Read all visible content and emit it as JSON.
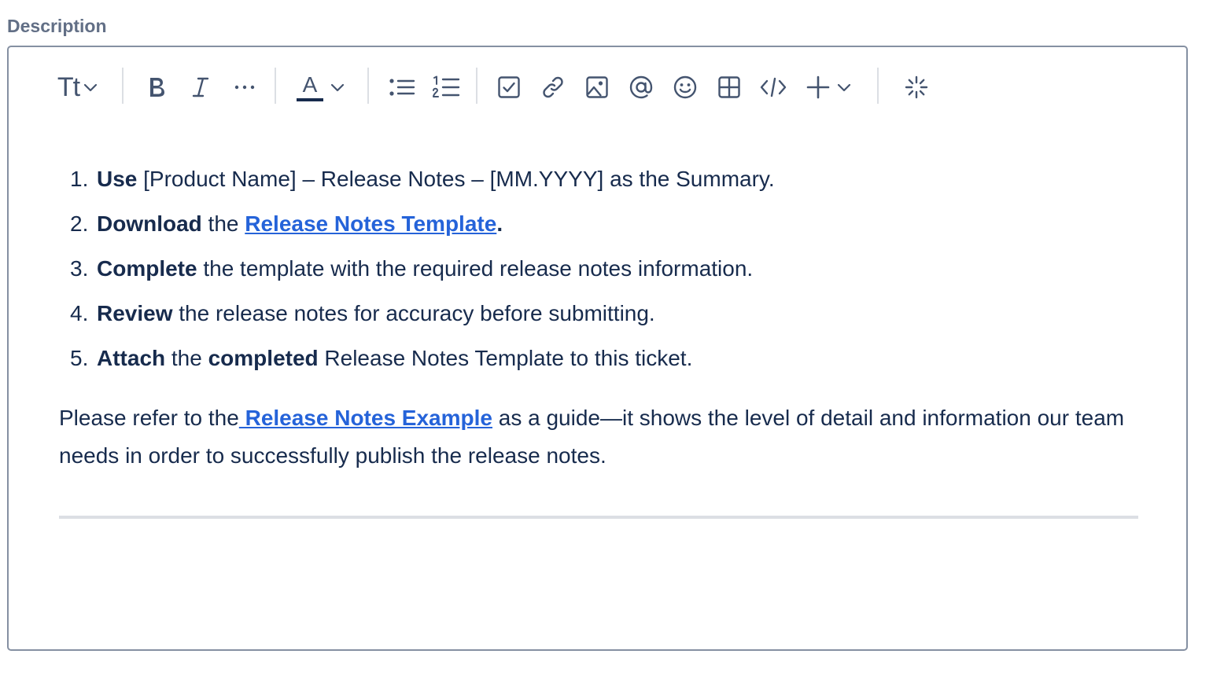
{
  "field": {
    "label": "Description"
  },
  "toolbar": {
    "text_style_label": "Tt",
    "font_color_letter": "A",
    "icons": [
      "text-style-icon",
      "bold-icon",
      "italic-icon",
      "more-formatting-icon",
      "text-color-icon",
      "bullet-list-icon",
      "numbered-list-icon",
      "checkbox-icon",
      "link-icon",
      "image-icon",
      "mention-icon",
      "emoji-icon",
      "table-icon",
      "code-icon",
      "insert-plus-icon",
      "ai-sparkle-icon"
    ]
  },
  "content": {
    "steps": [
      {
        "num": "1.",
        "parts": [
          {
            "text": "Use",
            "bold": true
          },
          {
            "text": " [Product Name] – Release Notes – [MM.YYYY] as the Summary."
          }
        ]
      },
      {
        "num": "2.",
        "parts": [
          {
            "text": "Download",
            "bold": true
          },
          {
            "text": " the "
          },
          {
            "text": "Release Notes Template",
            "link": true
          },
          {
            "text": ".",
            "bold": true
          }
        ]
      },
      {
        "num": "3.",
        "parts": [
          {
            "text": "Complete",
            "bold": true
          },
          {
            "text": " the template with the required release notes information."
          }
        ]
      },
      {
        "num": "4.",
        "parts": [
          {
            "text": "Review",
            "bold": true
          },
          {
            "text": " the release notes for accuracy before submitting."
          }
        ]
      },
      {
        "num": "5.",
        "parts": [
          {
            "text": "Attach",
            "bold": true
          },
          {
            "text": " the "
          },
          {
            "text": "completed",
            "bold": true
          },
          {
            "text": " Release Notes Template to this ticket."
          }
        ]
      }
    ],
    "paragraph": {
      "before": "Please refer to the",
      "link": " Release Notes Example",
      "after": " as a guide—it shows the level of detail and information our team needs in order to successfully publish the release notes."
    }
  },
  "colors": {
    "link": "#2563d9",
    "text": "#172b4d",
    "icon": "#44546f",
    "border": "#8590a2",
    "divider": "#dcdfe4"
  }
}
